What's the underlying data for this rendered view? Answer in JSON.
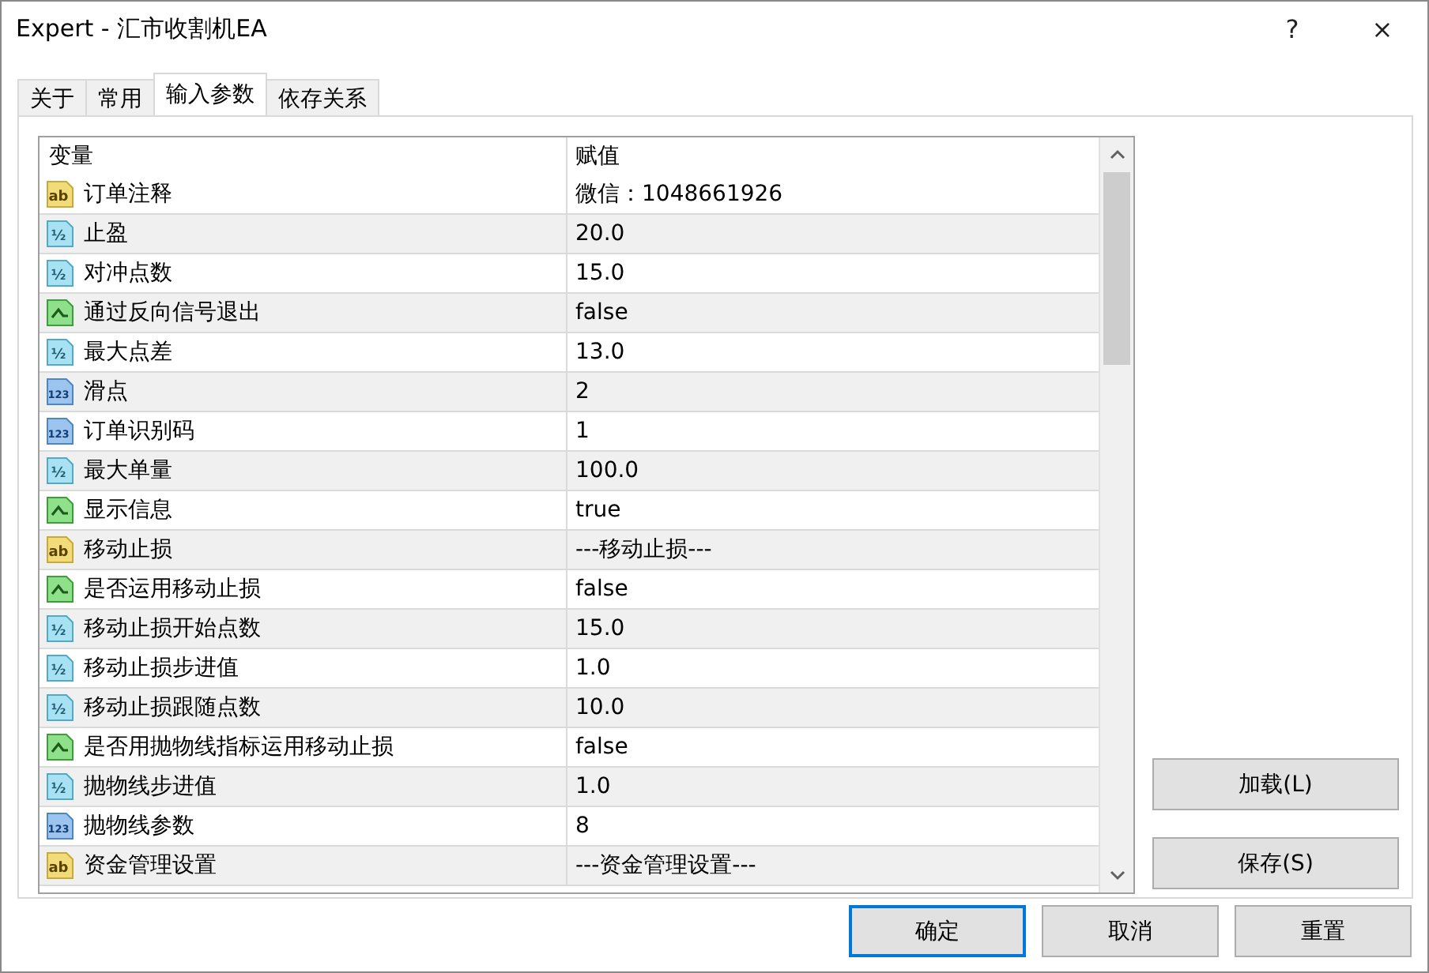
{
  "window": {
    "title": "Expert - 汇市收割机EA",
    "help": "?",
    "close": "×"
  },
  "tabs": [
    {
      "label": "关于",
      "selected": false
    },
    {
      "label": "常用",
      "selected": false
    },
    {
      "label": "输入参数",
      "selected": true
    },
    {
      "label": "依存关系",
      "selected": false
    }
  ],
  "table": {
    "columns": [
      "变量",
      "赋值"
    ],
    "rows": [
      {
        "kind": "string",
        "badge": "ab",
        "name": "订单注释",
        "value": "微信：1048661926"
      },
      {
        "kind": "double",
        "badge": "½",
        "name": "止盈",
        "value": "20.0"
      },
      {
        "kind": "double",
        "badge": "½",
        "name": "对冲点数",
        "value": "15.0"
      },
      {
        "kind": "bool",
        "name": "通过反向信号退出",
        "value": "false"
      },
      {
        "kind": "double",
        "badge": "½",
        "name": "最大点差",
        "value": "13.0"
      },
      {
        "kind": "int",
        "badge": "123",
        "name": "滑点",
        "value": "2"
      },
      {
        "kind": "int",
        "badge": "123",
        "name": "订单识别码",
        "value": "1"
      },
      {
        "kind": "double",
        "badge": "½",
        "name": "最大单量",
        "value": "100.0"
      },
      {
        "kind": "bool",
        "name": "显示信息",
        "value": "true"
      },
      {
        "kind": "string",
        "badge": "ab",
        "name": "移动止损",
        "value": "---移动止损---"
      },
      {
        "kind": "bool",
        "name": "是否运用移动止损",
        "value": "false"
      },
      {
        "kind": "double",
        "badge": "½",
        "name": "移动止损开始点数",
        "value": "15.0"
      },
      {
        "kind": "double",
        "badge": "½",
        "name": "移动止损步进值",
        "value": "1.0"
      },
      {
        "kind": "double",
        "badge": "½",
        "name": "移动止损跟随点数",
        "value": "10.0"
      },
      {
        "kind": "bool",
        "name": "是否用抛物线指标运用移动止损",
        "value": "false"
      },
      {
        "kind": "double",
        "badge": "½",
        "name": "抛物线步进值",
        "value": "1.0"
      },
      {
        "kind": "int",
        "badge": "123",
        "name": "抛物线参数",
        "value": "8"
      },
      {
        "kind": "string",
        "badge": "ab",
        "name": "资金管理设置",
        "value": "---资金管理设置---"
      }
    ]
  },
  "side_buttons": [
    "加载(L)",
    "保存(S)"
  ],
  "buttons": [
    {
      "label": "确定",
      "default": true
    },
    {
      "label": "取消",
      "default": false
    },
    {
      "label": "重置",
      "default": false
    }
  ]
}
